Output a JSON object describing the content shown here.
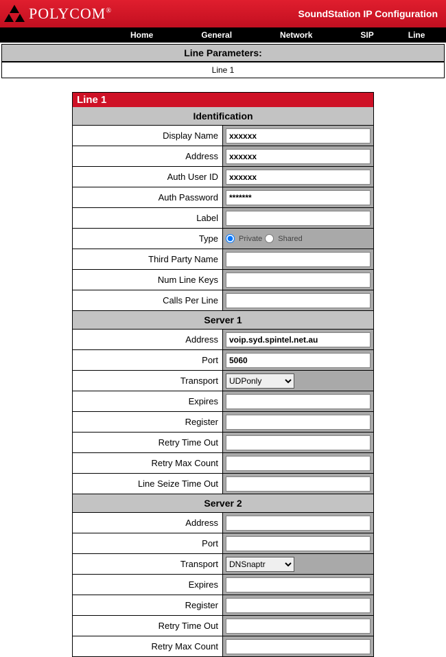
{
  "brand": "POLYCOM",
  "header_title": "SoundStation IP Configuration",
  "nav": {
    "items": [
      "Home",
      "General",
      "Network",
      "SIP",
      "Line"
    ]
  },
  "lineparams": {
    "label": "Line Parameters:",
    "line_number": "Line 1"
  },
  "form": {
    "title": "Line 1",
    "sections": {
      "identification": {
        "heading": "Identification",
        "fields": {
          "display_name": {
            "label": "Display Name",
            "value": "xxxxxx"
          },
          "address": {
            "label": "Address",
            "value": "xxxxxx"
          },
          "auth_user_id": {
            "label": "Auth User ID",
            "value": "xxxxxx"
          },
          "auth_password": {
            "label": "Auth Password",
            "value": "*******"
          },
          "label": {
            "label": "Label",
            "value": ""
          },
          "type": {
            "label": "Type",
            "options": [
              "Private",
              "Shared"
            ],
            "value": "Private"
          },
          "third_party_name": {
            "label": "Third Party Name",
            "value": ""
          },
          "num_line_keys": {
            "label": "Num Line Keys",
            "value": ""
          },
          "calls_per_line": {
            "label": "Calls Per Line",
            "value": ""
          }
        }
      },
      "server1": {
        "heading": "Server 1",
        "fields": {
          "address": {
            "label": "Address",
            "value": "voip.syd.spintel.net.au"
          },
          "port": {
            "label": "Port",
            "value": "5060"
          },
          "transport": {
            "label": "Transport",
            "value": "UDPonly"
          },
          "expires": {
            "label": "Expires",
            "value": ""
          },
          "register": {
            "label": "Register",
            "value": ""
          },
          "retry_time_out": {
            "label": "Retry Time Out",
            "value": ""
          },
          "retry_max_count": {
            "label": "Retry Max Count",
            "value": ""
          },
          "line_seize_time_out": {
            "label": "Line Seize Time Out",
            "value": ""
          }
        }
      },
      "server2": {
        "heading": "Server 2",
        "fields": {
          "address": {
            "label": "Address",
            "value": ""
          },
          "port": {
            "label": "Port",
            "value": ""
          },
          "transport": {
            "label": "Transport",
            "value": "DNSnaptr"
          },
          "expires": {
            "label": "Expires",
            "value": ""
          },
          "register": {
            "label": "Register",
            "value": ""
          },
          "retry_time_out": {
            "label": "Retry Time Out",
            "value": ""
          },
          "retry_max_count": {
            "label": "Retry Max Count",
            "value": ""
          }
        }
      }
    }
  }
}
